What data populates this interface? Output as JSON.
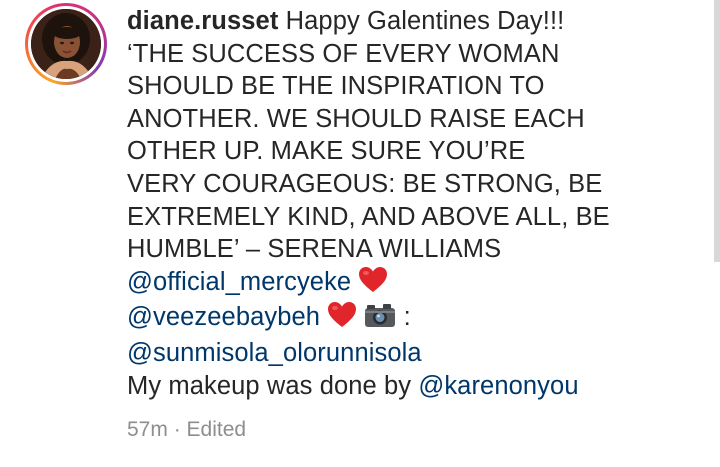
{
  "comment": {
    "username": "diane.russet",
    "lines": [
      "Happy Galentines Day!!!",
      "‘THE SUCCESS OF EVERY WOMAN",
      "SHOULD BE THE INSPIRATION TO",
      "ANOTHER. WE SHOULD RAISE EACH",
      "OTHER UP. MAKE SURE YOU’RE",
      "VERY COURAGEOUS: BE STRONG, BE",
      "EXTREMELY KIND, AND ABOVE ALL, BE",
      "HUMBLE’ – SERENA WILLIAMS"
    ],
    "mentions": {
      "m1": "@official_mercyeke",
      "m2": "@veezeebaybeh",
      "m3": "@sunmisola_olorunnisola",
      "m4": "@karenonyou"
    },
    "colon_text": ":",
    "makeup_text": "My makeup was done by",
    "emoji": {
      "heart": "red-heart-emoji",
      "camera": "camera-emoji"
    },
    "time": "57m",
    "separator": "·",
    "edited": "Edited"
  },
  "colors": {
    "text": "#262626",
    "mention": "#00376b",
    "meta": "#8e8e8e",
    "heart": "#e0262b"
  }
}
